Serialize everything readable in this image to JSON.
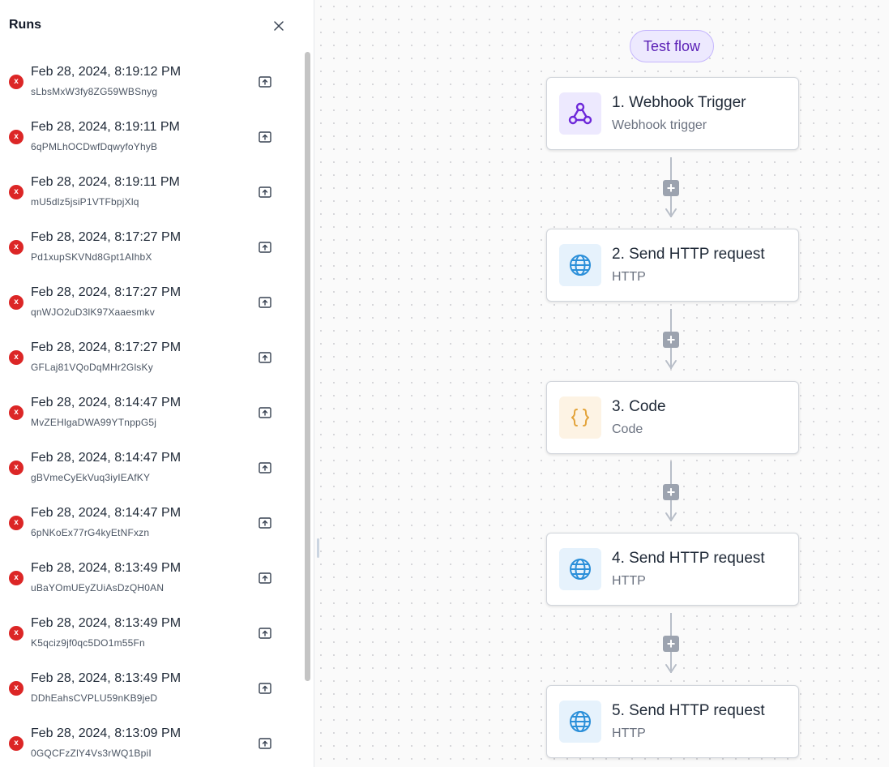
{
  "runs_panel": {
    "title": "Runs",
    "runs": [
      {
        "date": "Feb 28, 2024, 8:19:12 PM",
        "id": "sLbsMxW3fy8ZG59WBSnyg",
        "status": "x"
      },
      {
        "date": "Feb 28, 2024, 8:19:11 PM",
        "id": "6qPMLhOCDwfDqwyfoYhyB",
        "status": "x"
      },
      {
        "date": "Feb 28, 2024, 8:19:11 PM",
        "id": "mU5dlz5jsiP1VTFbpjXlq",
        "status": "x"
      },
      {
        "date": "Feb 28, 2024, 8:17:27 PM",
        "id": "Pd1xupSKVNd8Gpt1AIhbX",
        "status": "x"
      },
      {
        "date": "Feb 28, 2024, 8:17:27 PM",
        "id": "qnWJO2uD3lK97Xaaesmkv",
        "status": "x"
      },
      {
        "date": "Feb 28, 2024, 8:17:27 PM",
        "id": "GFLaj81VQoDqMHr2GlsKy",
        "status": "x"
      },
      {
        "date": "Feb 28, 2024, 8:14:47 PM",
        "id": "MvZEHlgaDWA99YTnppG5j",
        "status": "x"
      },
      {
        "date": "Feb 28, 2024, 8:14:47 PM",
        "id": "gBVmeCyEkVuq3iyIEAfKY",
        "status": "x"
      },
      {
        "date": "Feb 28, 2024, 8:14:47 PM",
        "id": "6pNKoEx77rG4kyEtNFxzn",
        "status": "x"
      },
      {
        "date": "Feb 28, 2024, 8:13:49 PM",
        "id": "uBaYOmUEyZUiAsDzQH0AN",
        "status": "x"
      },
      {
        "date": "Feb 28, 2024, 8:13:49 PM",
        "id": "K5qciz9jf0qc5DO1m55Fn",
        "status": "x"
      },
      {
        "date": "Feb 28, 2024, 8:13:49 PM",
        "id": "DDhEahsCVPLU59nKB9jeD",
        "status": "x"
      },
      {
        "date": "Feb 28, 2024, 8:13:09 PM",
        "id": "0GQCFzZlY4Vs3rWQ1BpiI",
        "status": "x"
      }
    ]
  },
  "canvas": {
    "test_flow_label": "Test flow",
    "add_step_label": "+",
    "steps": [
      {
        "title": "1. Webhook Trigger",
        "subtitle": "Webhook trigger",
        "icon": "webhook-icon"
      },
      {
        "title": "2. Send HTTP request",
        "subtitle": "HTTP",
        "icon": "globe-icon"
      },
      {
        "title": "3. Code",
        "subtitle": "Code",
        "icon": "code-braces-icon"
      },
      {
        "title": "4. Send HTTP request",
        "subtitle": "HTTP",
        "icon": "globe-icon"
      },
      {
        "title": "5. Send HTTP request",
        "subtitle": "HTTP",
        "icon": "globe-icon"
      }
    ]
  },
  "colors": {
    "error": "#dc2626",
    "accent_purple": "#6d28d9",
    "http_blue": "#2b8fd9",
    "code_orange": "#e3a33a"
  }
}
